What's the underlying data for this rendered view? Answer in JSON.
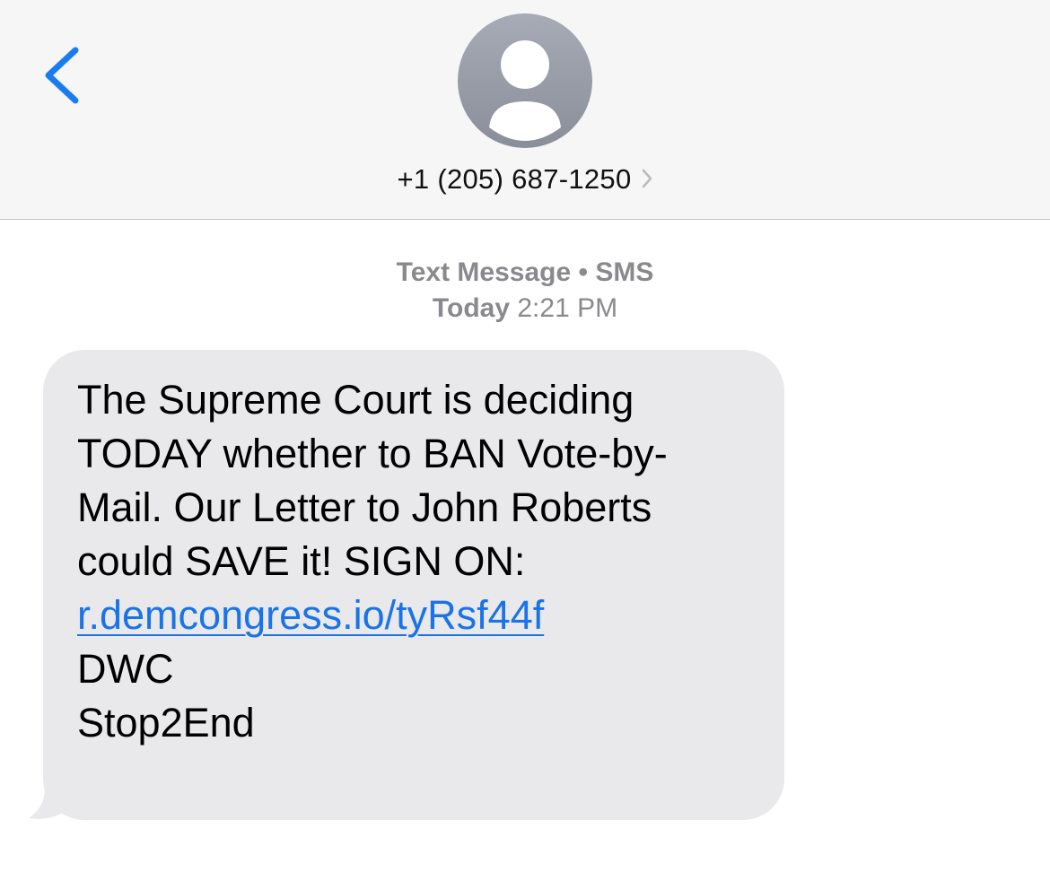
{
  "header": {
    "back_icon": "chevron-left-icon",
    "avatar_icon": "person-icon",
    "contact_number": "+1 (205) 687-1250",
    "contact_chevron_icon": "chevron-right-icon",
    "accent_color": "#1a7cf2"
  },
  "conversation": {
    "service_label": "Text Message • SMS",
    "timestamp_day": "Today",
    "timestamp_time": "2:21 PM"
  },
  "message": {
    "lines": [
      "The Supreme Court is deciding",
      "TODAY whether to BAN Vote-by-",
      "Mail. Our Letter to John Roberts",
      "could SAVE it! SIGN ON:"
    ],
    "link_text": "r.demcongress.io/tyRsf44f",
    "link_color": "#1a73e8",
    "signature": "DWC",
    "opt_out": "Stop2End",
    "bubble_color": "#e9e9eb"
  }
}
